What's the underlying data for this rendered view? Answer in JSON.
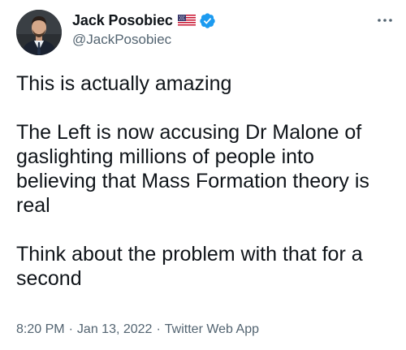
{
  "author": {
    "display_name": "Jack Posobiec",
    "handle": "@JackPosobiec",
    "icons": [
      "us-flag-icon",
      "verified-badge-icon"
    ],
    "verified_color": "#1d9bf0"
  },
  "tweet": {
    "paragraphs": [
      "This is actually amazing",
      "The Left is now accusing Dr Malone of gaslighting millions of people into believing that Mass Formation theory is real",
      "Think about the problem with that for a second"
    ]
  },
  "meta": {
    "time": "8:20 PM",
    "separator": "·",
    "date": "Jan 13, 2022",
    "source": "Twitter Web App"
  },
  "colors": {
    "text": "#0f1419",
    "secondary": "#536471"
  }
}
